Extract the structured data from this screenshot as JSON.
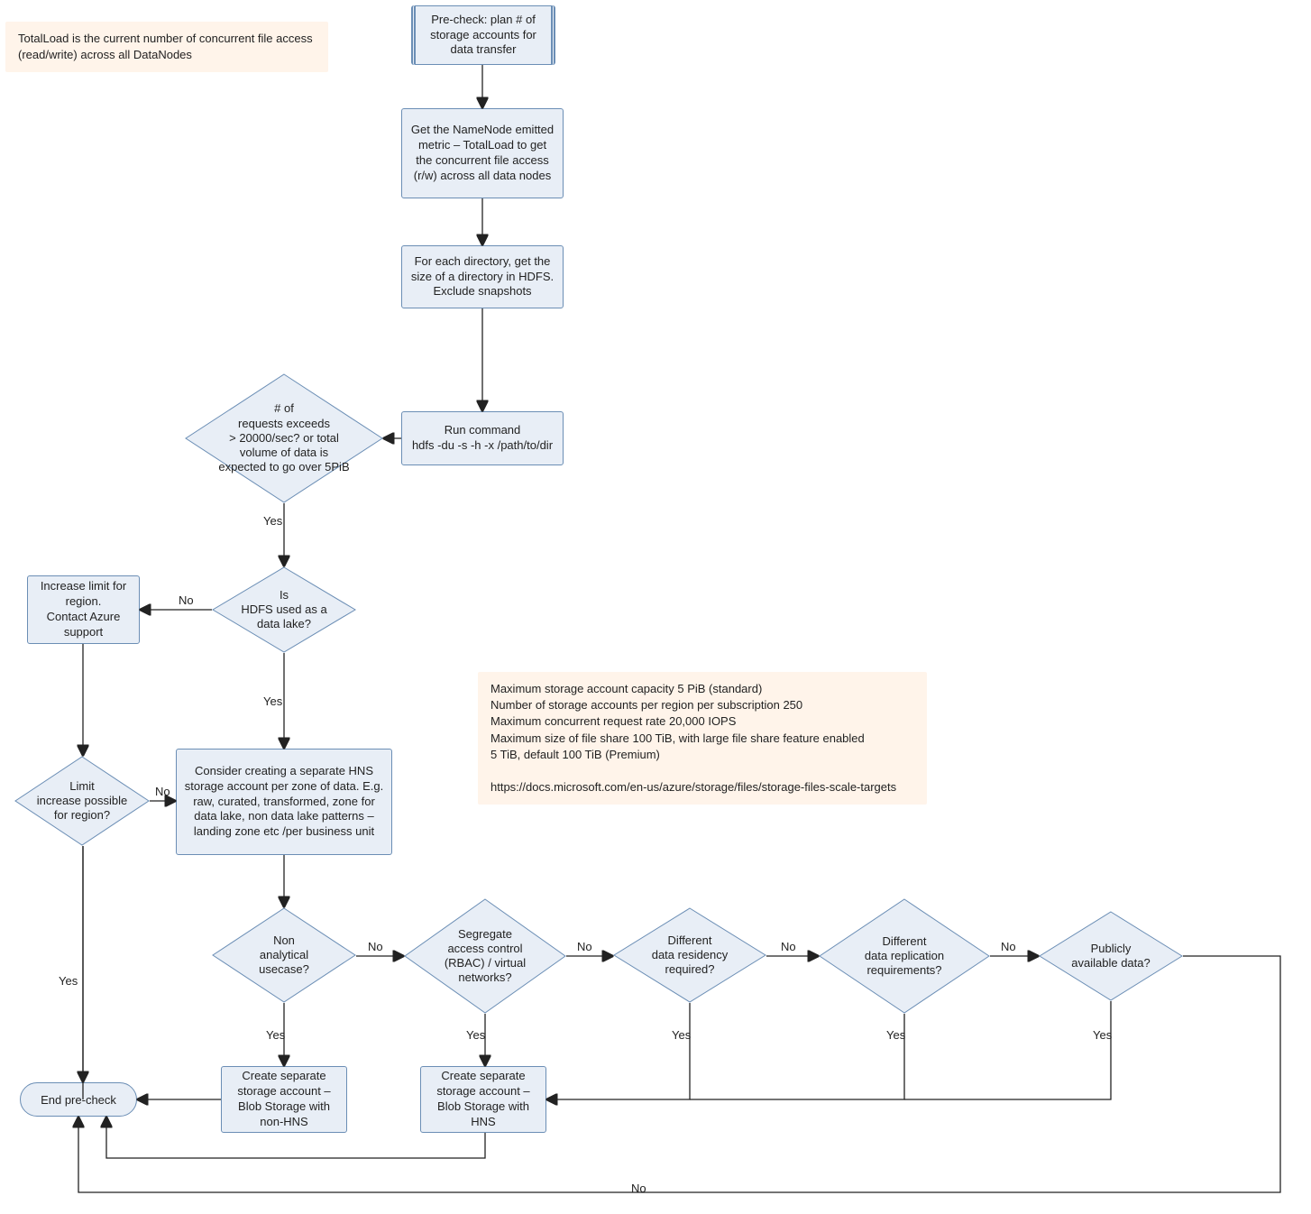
{
  "notes": {
    "totalload": "TotalLoad is the current number of concurrent file access (read/write) across all DataNodes",
    "limits": "Maximum storage account capacity 5 PiB (standard)\nNumber of storage accounts per region per subscription 250\nMaximum concurrent request rate 20,000 IOPS\nMaximum size of file share 100 TiB, with large file share feature enabled\n5 TiB, default 100 TiB (Premium)\n\nhttps://docs.microsoft.com/en-us/azure/storage/files/storage-files-scale-targets"
  },
  "boxes": {
    "precheck": "Pre-check: plan # of storage accounts for data transfer",
    "namenode": "Get the NameNode emitted metric – TotalLoad to get the concurrent file access (r/w) across all data nodes",
    "dirsize": "For each directory, get the size of a directory in HDFS. Exclude snapshots",
    "runcmd": "Run command\nhdfs -du -s -h -x /path/to/dir",
    "increaselimit": "Increase limit for region.\nContact Azure support",
    "hns": "Consider creating a separate HNS storage account per zone of data. E.g. raw, curated, transformed, zone for data lake, non data lake patterns – landing zone etc /per business unit",
    "create_nonhns": "Create separate storage account – Blob Storage with non-HNS",
    "create_hns": "Create separate storage account – Blob Storage with HNS",
    "endprecheck": "End pre-check"
  },
  "decisions": {
    "requests": "# of\nrequests exceeds\n> 20000/sec? or total volume of data is expected to go over 5PiB",
    "datalake": "Is\nHDFS used as a data lake?",
    "limitpossible": "Limit\nincrease possible for region?",
    "nonanalytical": "Non\nanalytical usecase?",
    "segregate": "Segregate\naccess control (RBAC) / virtual networks?",
    "residency": "Different\ndata residency required?",
    "replication": "Different\ndata replication requirements?",
    "public": "Publicly\navailable data?"
  },
  "labels": {
    "yes": "Yes",
    "no": "No"
  }
}
